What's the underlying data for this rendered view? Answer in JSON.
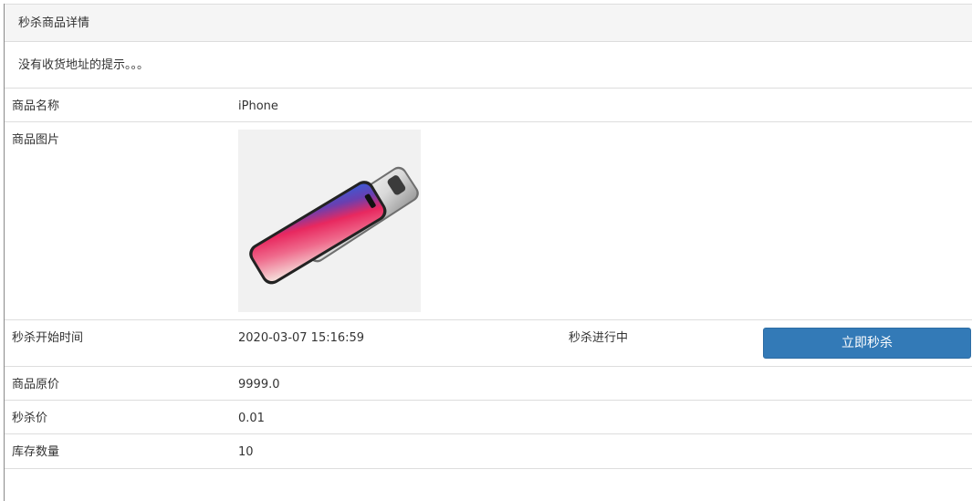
{
  "panel": {
    "heading": "秒杀商品详情",
    "notice": "没有收货地址的提示。。。"
  },
  "goods": {
    "name_label": "商品名称",
    "name_value": "iPhone",
    "image_label": "商品图片",
    "image_icon": "iphone-product-icon",
    "start_time_label": "秒杀开始时间",
    "start_time_value": "2020-03-07 15:16:59",
    "status": "秒杀进行中",
    "buy_button_label": "立即秒杀",
    "original_price_label": "商品原价",
    "original_price_value": "9999.0",
    "seckill_price_label": "秒杀价",
    "seckill_price_value": "0.01",
    "stock_label": "库存数量",
    "stock_value": "10"
  },
  "colors": {
    "button_primary": "#337ab7",
    "heading_bg": "#f5f5f5"
  }
}
